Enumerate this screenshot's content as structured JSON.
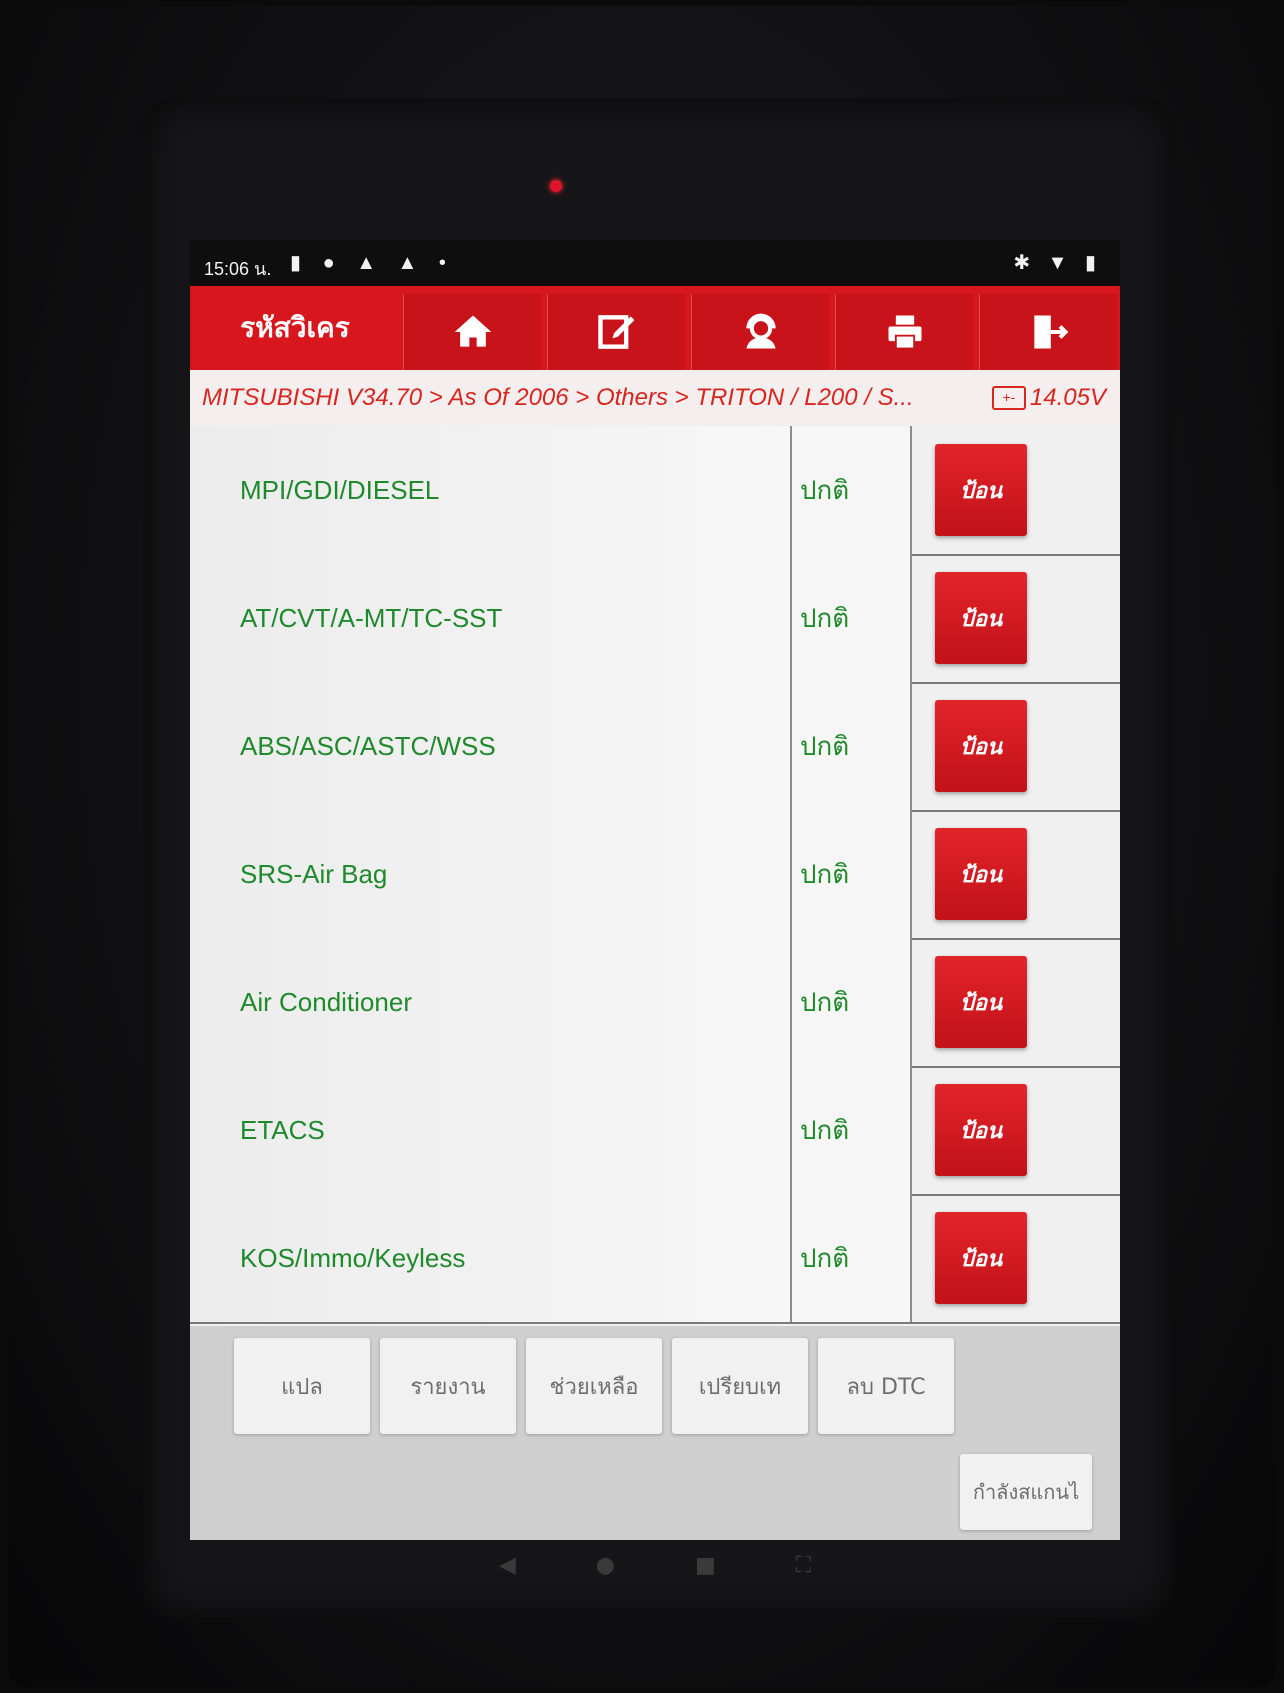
{
  "status_bar": {
    "time": "15:06 น.",
    "left_icons": "▮ ● ▲ ▲ •",
    "right_icons": "✱ ▼ ▮"
  },
  "toolbar": {
    "title": "รหัสวิเคร",
    "buttons": [
      {
        "icon": "home-icon"
      },
      {
        "icon": "edit-icon"
      },
      {
        "icon": "support-icon"
      },
      {
        "icon": "print-icon"
      },
      {
        "icon": "exit-icon"
      }
    ]
  },
  "breadcrumb": {
    "path": "MITSUBISHI V34.70 > As Of 2006 > Others > TRITON / L200 / S...",
    "voltage": "14.05V",
    "battery_symbol": "+-"
  },
  "systems": [
    {
      "name": "MPI/GDI/DIESEL",
      "status": "ปกติ",
      "action": "ป้อน"
    },
    {
      "name": "AT/CVT/A-MT/TC-SST",
      "status": "ปกติ",
      "action": "ป้อน"
    },
    {
      "name": "ABS/ASC/ASTC/WSS",
      "status": "ปกติ",
      "action": "ป้อน"
    },
    {
      "name": "SRS-Air Bag",
      "status": "ปกติ",
      "action": "ป้อน"
    },
    {
      "name": "Air Conditioner",
      "status": "ปกติ",
      "action": "ป้อน"
    },
    {
      "name": "ETACS",
      "status": "ปกติ",
      "action": "ป้อน"
    },
    {
      "name": "KOS/Immo/Keyless",
      "status": "ปกติ",
      "action": "ป้อน"
    }
  ],
  "bottom_buttons": {
    "translate": "แปล",
    "report": "รายงาน",
    "help": "ช่วยเหลือ",
    "compare": "เปรียบเท",
    "clear_dtc": "ลบ DTC",
    "more": "กำลังสแกนไ"
  },
  "nav_bar": {
    "back": "◀",
    "home": "●",
    "recents": "■",
    "screenshot": "⛶"
  },
  "colors": {
    "accent_red": "#d7161e",
    "text_green": "#1e8a2b",
    "breadcrumb_red": "#d8261f"
  }
}
